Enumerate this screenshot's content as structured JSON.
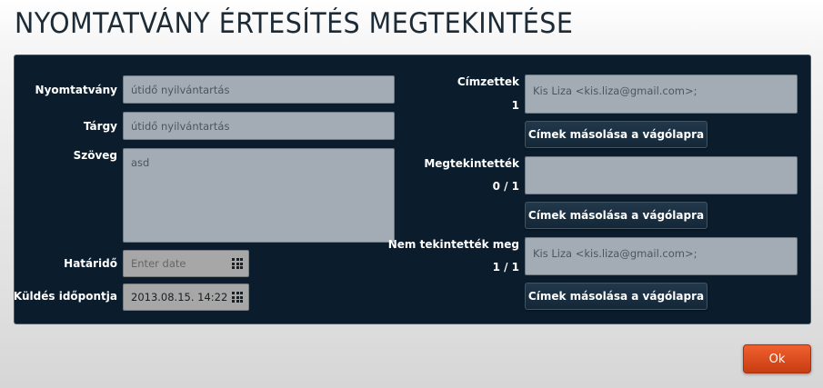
{
  "page": {
    "title": "NYOMTATVÁNY ÉRTESÍTÉS MEGTEKINTÉSE"
  },
  "left": {
    "form_label": "Nyomtatvány",
    "form_value": "útidő nyilvántartás",
    "subject_label": "Tárgy",
    "subject_value": "útidő nyilvántartás",
    "text_label": "Szöveg",
    "text_value": "asd",
    "deadline_label": "Határidő",
    "deadline_placeholder": "Enter date",
    "sent_label": "Küldés időpontja",
    "sent_value": "2013.08.15. 14:22"
  },
  "right": {
    "recipients_label": "Címzettek",
    "recipients_count": "1",
    "recipients_value": "Kis Liza <kis.liza@gmail.com>;",
    "viewed_label": "Megtekintették",
    "viewed_count": "0 / 1",
    "viewed_value": "",
    "not_viewed_label": "Nem tekintették meg",
    "not_viewed_count": "1 / 1",
    "not_viewed_value": "Kis Liza <kis.liza@gmail.com>;",
    "copy_label": "Címek másolása a vágólapra"
  },
  "footer": {
    "ok_label": "Ok"
  }
}
